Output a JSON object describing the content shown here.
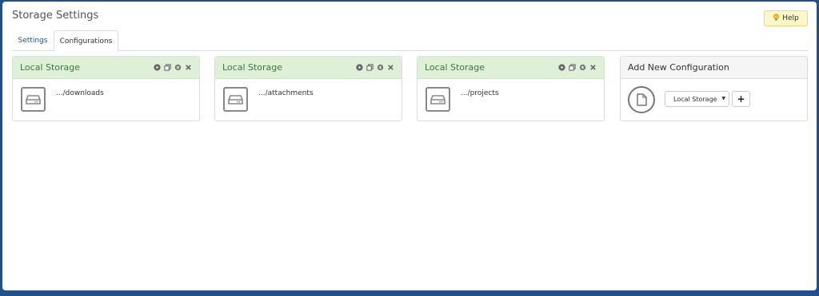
{
  "page": {
    "title": "Storage Settings"
  },
  "help": {
    "label": "Help",
    "icon": "lightbulb-icon"
  },
  "tabs": [
    {
      "label": "Settings",
      "active": false
    },
    {
      "label": "Configurations",
      "active": true
    }
  ],
  "configurations": [
    {
      "title": "Local Storage",
      "path": ".../downloads"
    },
    {
      "title": "Local Storage",
      "path": ".../attachments"
    },
    {
      "title": "Local Storage",
      "path": ".../projects"
    }
  ],
  "card_tools": [
    "play-icon",
    "copy-icon",
    "gear-icon",
    "close-icon"
  ],
  "add_new": {
    "title": "Add New Configuration",
    "selected_type": "Local Storage",
    "add_label": "+"
  },
  "colors": {
    "frame": "#24508a",
    "card_header_bg": "#dff0d8",
    "card_header_text": "#3c763d",
    "help_bg": "#fbf7c7"
  }
}
